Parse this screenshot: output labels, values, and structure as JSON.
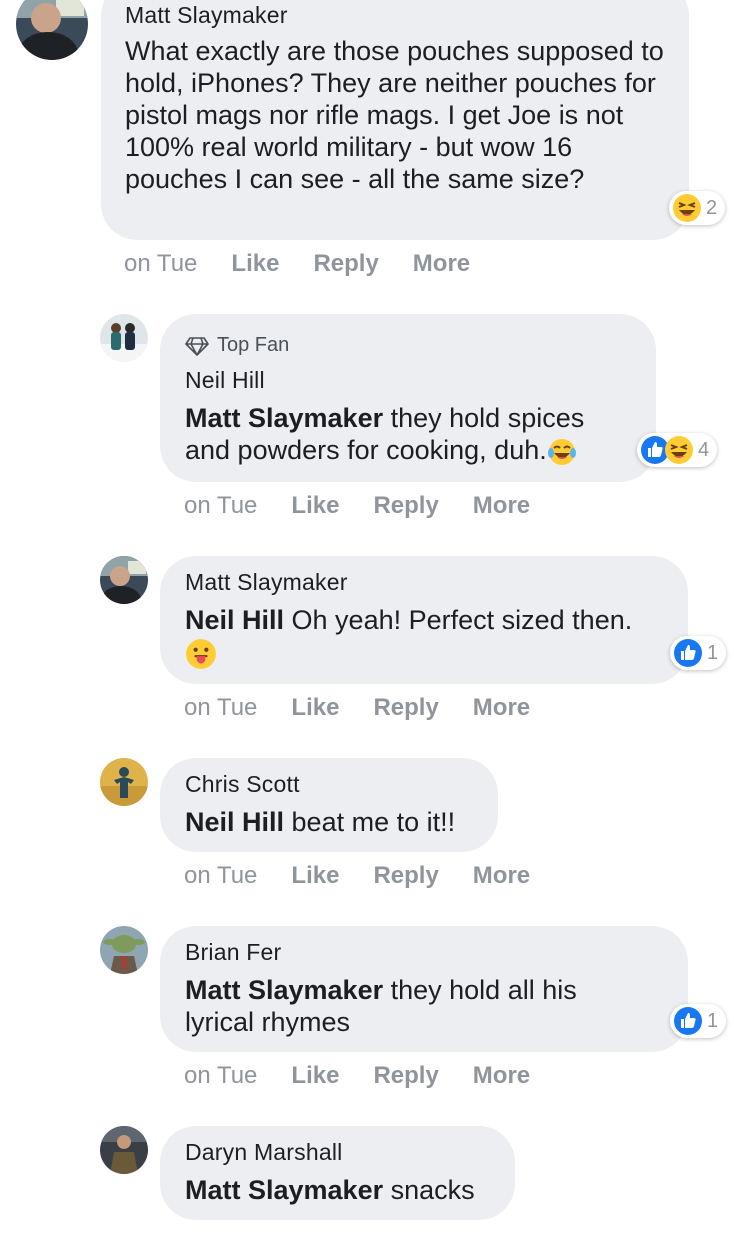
{
  "comments": [
    {
      "author": "Matt Slaymaker",
      "segments": [
        {
          "text": "What exactly are those pouches supposed to hold, iPhones? They are neither pouches for pistol mags nor rifle mags. I get Joe is not 100% real world military - but wow 16 pouches I can see - all the same size?",
          "bold": false
        }
      ],
      "reactions": {
        "icons": [
          "laughing-emoji"
        ],
        "count": "2"
      },
      "time": "on Tue",
      "actions": [
        "Like",
        "Reply",
        "More"
      ]
    },
    {
      "badge": "Top Fan",
      "author": "Neil Hill",
      "segments": [
        {
          "text": "Matt Slaymaker",
          "bold": true
        },
        {
          "text": " they hold spices and powders for cooking, duh.",
          "bold": false
        }
      ],
      "inline_emoji": "tears-of-joy-emoji",
      "reactions": {
        "icons": [
          "like",
          "laughing-emoji"
        ],
        "count": "4"
      },
      "time": "on Tue",
      "actions": [
        "Like",
        "Reply",
        "More"
      ]
    },
    {
      "author": "Matt Slaymaker",
      "segments": [
        {
          "text": "Neil Hill",
          "bold": true
        },
        {
          "text": " Oh yeah! Perfect sized then.",
          "bold": false
        }
      ],
      "inline_emoji": "tongue-out-emoji",
      "reactions": {
        "icons": [
          "like"
        ],
        "count": "1"
      },
      "time": "on Tue",
      "actions": [
        "Like",
        "Reply",
        "More"
      ]
    },
    {
      "author": "Chris Scott",
      "segments": [
        {
          "text": "Neil Hill",
          "bold": true
        },
        {
          "text": " beat me to it!!",
          "bold": false
        }
      ],
      "time": "on Tue",
      "actions": [
        "Like",
        "Reply",
        "More"
      ]
    },
    {
      "author": "Brian Fer",
      "segments": [
        {
          "text": "Matt Slaymaker",
          "bold": true
        },
        {
          "text": " they hold all his lyrical rhymes",
          "bold": false
        }
      ],
      "reactions": {
        "icons": [
          "like"
        ],
        "count": "1"
      },
      "time": "on Tue",
      "actions": [
        "Like",
        "Reply",
        "More"
      ]
    },
    {
      "author": "Daryn Marshall",
      "segments": [
        {
          "text": "Matt Slaymaker",
          "bold": true
        },
        {
          "text": " snacks",
          "bold": false
        }
      ]
    }
  ],
  "colors": {
    "bubble": "#eceef1",
    "meta_text": "#90949c",
    "like_blue": "#1877f2",
    "emoji_yellow": "#ffcc33"
  }
}
